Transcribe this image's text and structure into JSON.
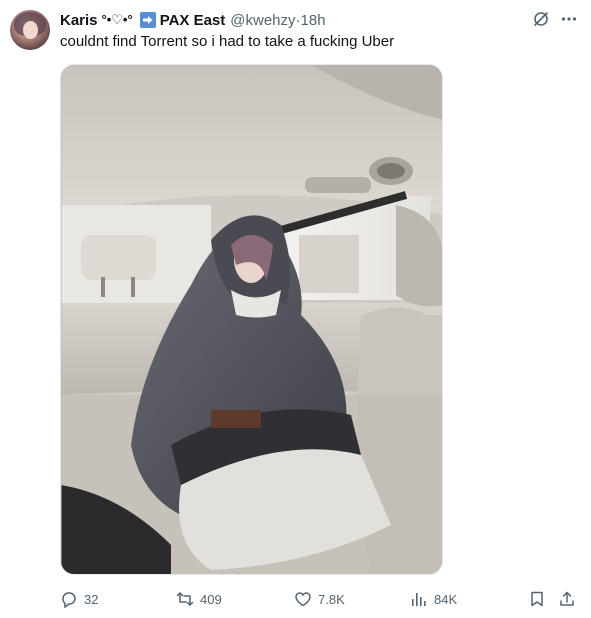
{
  "tweet": {
    "author_name": "Karis",
    "author_deco": "°•♡•°",
    "event_name": "PAX East",
    "handle": "@kwehzy",
    "separator": " · ",
    "time": "18h",
    "text": "couldnt find Torrent so i had to take a fucking Uber"
  },
  "media": {
    "alt_subject": "photo-in-car"
  },
  "actions": {
    "replies": "32",
    "reposts": "409",
    "likes": "7.8K",
    "views": "84K"
  },
  "icons": {
    "grok": "grok-icon",
    "more": "more-icon",
    "reply": "reply-icon",
    "repost": "repost-icon",
    "like": "heart-icon",
    "views": "views-icon",
    "bookmark": "bookmark-icon",
    "share": "share-icon"
  },
  "colors": {
    "text": "#0f1419",
    "secondary": "#536471",
    "badge": "#5b8dd6"
  }
}
